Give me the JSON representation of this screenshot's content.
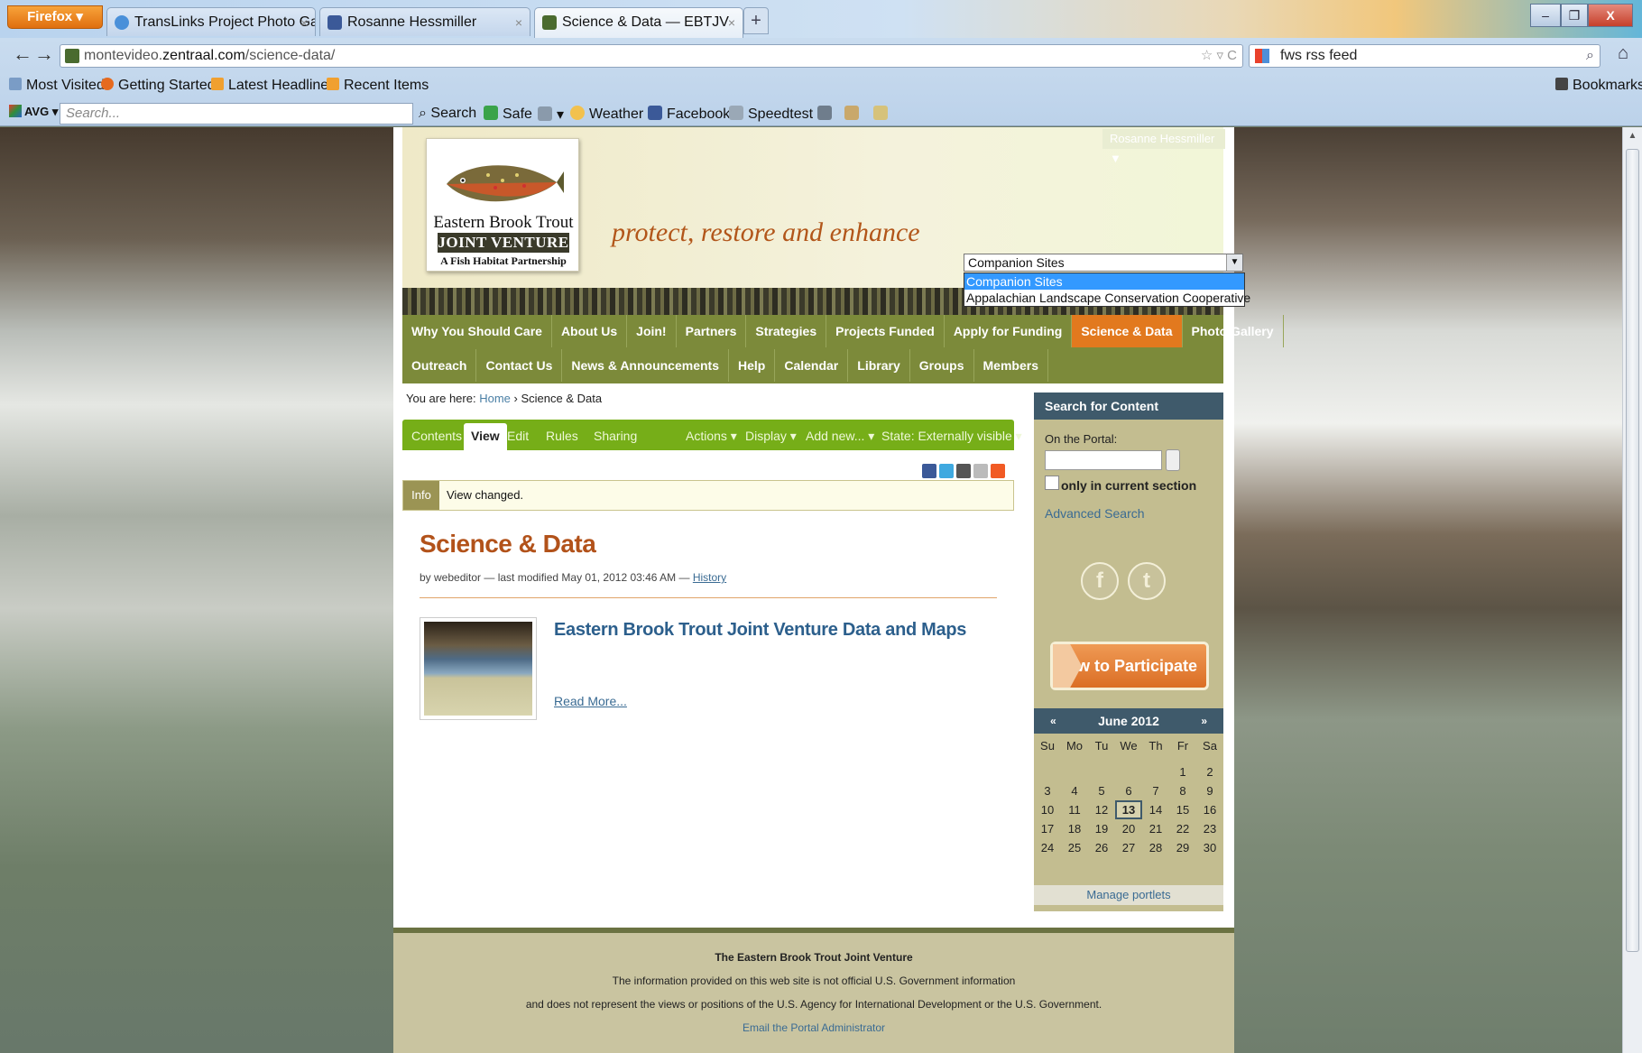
{
  "browser": {
    "firefox_button": "Firefox",
    "tabs": [
      {
        "label": "TransLinks Project Photo Gall...",
        "close": "×"
      },
      {
        "label": "Rosanne Hessmiller",
        "close": "×"
      },
      {
        "label": "Science & Data — EBTJV",
        "close": "×"
      }
    ],
    "new_tab": "+",
    "window": {
      "minimize": "–",
      "maximize": "❐",
      "close": "X"
    },
    "url": {
      "prefix": "montevideo.",
      "domain": "zentraal.com",
      "path": "/science-data/"
    },
    "url_controls": "☆ ▿ C",
    "feed_search": "fws rss feed",
    "bookmarks_toolbar": [
      "Most Visited",
      "Getting Started",
      "Latest Headlines",
      "Recent Items"
    ],
    "bookmarks_menu": "Bookmarks",
    "avg": {
      "logo": "AVG",
      "search_placeholder": "Search...",
      "search_button": "Search",
      "safe": "Safe",
      "weather": "Weather",
      "facebook": "Facebook",
      "speedtest": "Speedtest"
    }
  },
  "site": {
    "user_menu": "Rosanne Hessmiller ▼",
    "logo": {
      "line1": "Eastern Brook Trout",
      "line2": "JOINT VENTURE",
      "line3": "A Fish Habitat Partnership"
    },
    "tagline": "protect, restore and enhance",
    "companion": {
      "selected": "Companion Sites",
      "options": [
        "Companion Sites",
        "Appalachian Landscape Conservation Cooperative"
      ]
    },
    "nav_row1": [
      "Why You Should Care",
      "About Us",
      "Join!",
      "Partners",
      "Strategies",
      "Projects Funded",
      "Apply for Funding",
      "Science & Data",
      "Photo Gallery"
    ],
    "nav_row2": [
      "Outreach",
      "Contact Us",
      "News & Announcements",
      "Help",
      "Calendar",
      "Library",
      "Groups",
      "Members"
    ],
    "active_nav": "Science & Data"
  },
  "breadcrumb": {
    "prefix": "You are here:",
    "home": "Home",
    "sep": "›",
    "current": "Science & Data"
  },
  "editbar": {
    "tabs": [
      "Contents",
      "View",
      "Edit",
      "Rules",
      "Sharing"
    ],
    "active": "View",
    "menus": [
      "Actions ▾",
      "Display ▾",
      "Add new... ▾",
      "State: Externally visible ▾"
    ]
  },
  "info": {
    "label": "Info",
    "text": "View changed."
  },
  "content": {
    "title": "Science & Data",
    "byline_prefix": "by webeditor — last modified May 01, 2012 03:46 AM —",
    "history": "History",
    "item_title": "Eastern Brook Trout Joint Venture Data and Maps",
    "read_more": "Read More..."
  },
  "sidebar": {
    "search_title": "Search for Content",
    "on_portal": "On the Portal:",
    "only_section": "only in current section",
    "advanced": "Advanced Search",
    "facebook_glyph": "f",
    "twitter_glyph": "t",
    "participate": "How to Participate",
    "calendar": {
      "prev": "«",
      "next": "»",
      "month": "June 2012",
      "days": [
        "Su",
        "Mo",
        "Tu",
        "We",
        "Th",
        "Fr",
        "Sa"
      ],
      "weeks": [
        [
          "",
          "",
          "",
          "",
          "",
          "1",
          "2"
        ],
        [
          "3",
          "4",
          "5",
          "6",
          "7",
          "8",
          "9"
        ],
        [
          "10",
          "11",
          "12",
          "13",
          "14",
          "15",
          "16"
        ],
        [
          "17",
          "18",
          "19",
          "20",
          "21",
          "22",
          "23"
        ],
        [
          "24",
          "25",
          "26",
          "27",
          "28",
          "29",
          "30"
        ]
      ],
      "today": "13"
    },
    "manage": "Manage portlets"
  },
  "footer": {
    "title": "The Eastern Brook Trout Joint Venture",
    "line1": "The information provided on this web site is not official U.S. Government information",
    "line2": "and does not represent the views or positions of the U.S. Agency for International Development or the U.S. Government.",
    "email": "Email the Portal Administrator"
  },
  "colors": {
    "accent_orange": "#e2791e",
    "nav_green": "#7c8a3a",
    "editbar_green": "#76ae18",
    "portlet_header": "#3f5a6b"
  }
}
